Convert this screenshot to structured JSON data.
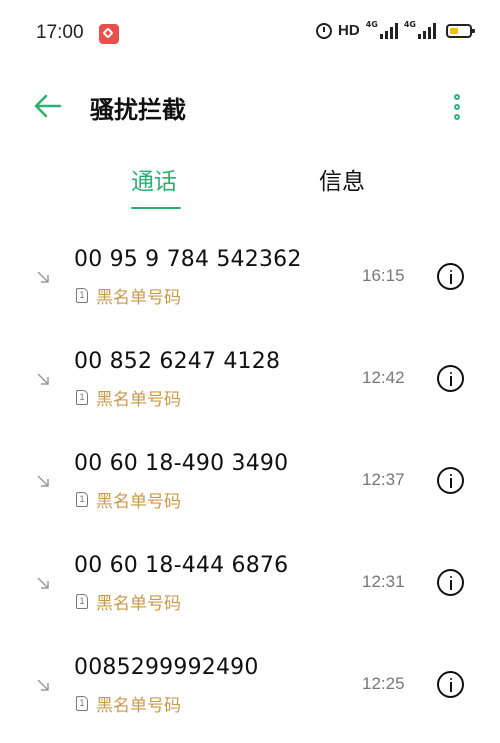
{
  "status_bar": {
    "time": "17:00",
    "hd_label": "HD",
    "network_label": "4G",
    "network_label_2": "4G",
    "icons": [
      "app-notification-icon",
      "alarm-icon",
      "signal-icon",
      "battery-icon"
    ],
    "battery_color": "#f2c200"
  },
  "app_bar": {
    "title": "骚扰拦截",
    "back_icon": "arrow-left-icon",
    "menu_icon": "more-vertical-icon"
  },
  "tabs": [
    {
      "label": "通话",
      "active": true
    },
    {
      "label": "信息",
      "active": false
    }
  ],
  "calls": [
    {
      "number": "00 95 9 784 542362",
      "tag": "黑名单号码",
      "time": "16:15"
    },
    {
      "number": "00 852 6247 4128",
      "tag": "黑名单号码",
      "time": "12:42"
    },
    {
      "number": "00 60 18-490 3490",
      "tag": "黑名单号码",
      "time": "12:37"
    },
    {
      "number": "00 60 18-444 6876",
      "tag": "黑名单号码",
      "time": "12:31"
    },
    {
      "number": "0085299992490",
      "tag": "黑名单号码",
      "time": "12:25"
    }
  ],
  "sim_label": "1",
  "colors": {
    "accent": "#2fae72",
    "tag": "#c79a4c",
    "time": "#777777"
  }
}
